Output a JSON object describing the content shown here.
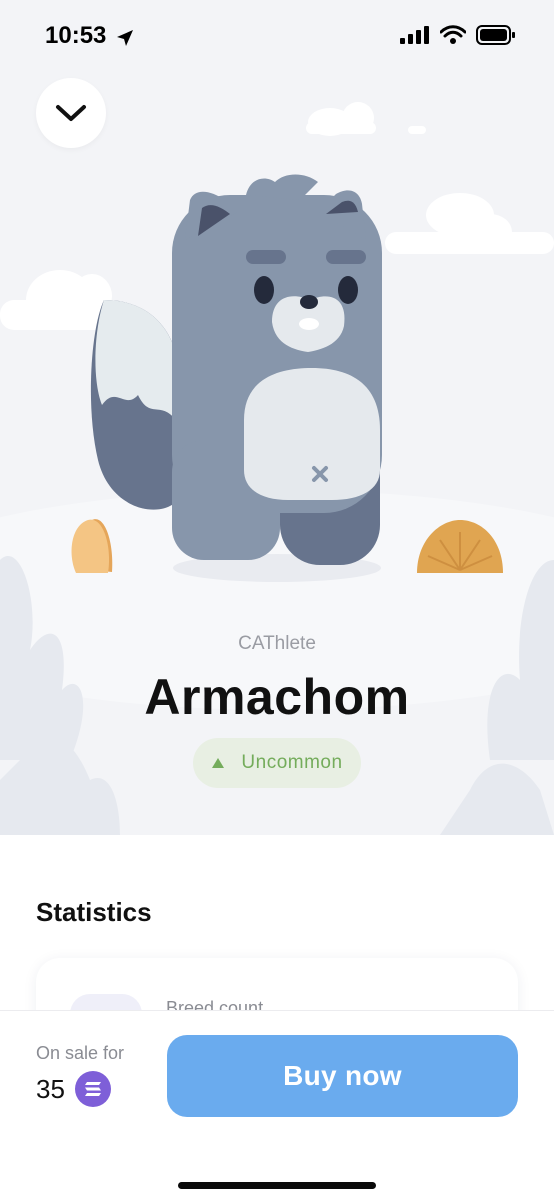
{
  "status_bar": {
    "time": "10:53",
    "icons": [
      "location-arrow-icon",
      "signal-icon",
      "wifi-icon",
      "battery-icon"
    ]
  },
  "header": {
    "collapse_icon": "chevron-down-icon"
  },
  "item": {
    "category": "CAThlete",
    "name": "Armachom",
    "rarity": {
      "label": "Uncommon",
      "icon": "triangle-up-icon",
      "color": "#74ac5b",
      "background": "#e8efe3"
    }
  },
  "statistics": {
    "title": "Statistics",
    "first_stat_label": "Breed count"
  },
  "purchase": {
    "sale_label": "On sale for",
    "price": "35",
    "currency_icon": "solana-icon",
    "buy_label": "Buy now",
    "button_color": "#6aabee"
  },
  "colors": {
    "hero_background": "#f3f4f7",
    "creature_body": "#8796ab",
    "creature_dark": "#67748d",
    "creature_belly": "#e5e9ed"
  }
}
